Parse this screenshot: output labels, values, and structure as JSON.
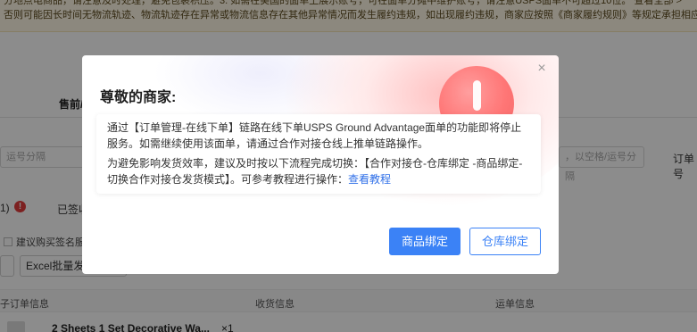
{
  "background": {
    "notice_line1": "分地点电商品，请注意及时处理，避免包裹积压。3. 如需在美国的面单上展示账号，可在面单分摊中维护账号，请注意USPS面单不可超过10位。  查看全部 >",
    "notice_line2": "否则可能因长时间无物流轨迹、物流轨迹存在异常或物流信息存在其他异常情况而发生履约违规，如出现履约违规，商家应按照《商家履约规则》等规定承担相应责任。",
    "notice_link": "查看全部 >",
    "tab_label": "售前/",
    "search_placeholder_left": "运号分隔",
    "search_placeholder_right": "，以空格/运号分隔",
    "search_label_right": "订单号",
    "status_count": "1)",
    "status_error_icon": "!",
    "status_signed": "已签收",
    "checkbox_label": "建议购买签名服务",
    "btn_excel": "Excel批量发",
    "table_col1": "子订单信息",
    "table_col2": "收货信息",
    "table_col3": "运单信息",
    "row_title": "2 Sheets 1 Set Decorative Wa...",
    "row_qty": "×1"
  },
  "dialog": {
    "title": "尊敬的商家:",
    "paragraph1": "通过【订单管理-在线下单】链路在线下单USPS Ground Advantage面单的功能即将停止服务。如需继续使用该面单，请通过合作对接仓线上推单链路操作。",
    "paragraph2_text": "为避免影响发货效率，建议及时按以下流程完成切换：【合作对接仓-仓库绑定 -商品绑定-切换合作对接仓发货模式】。可参考教程进行操作：",
    "paragraph2_link": "查看教程",
    "primary_button": "商品绑定",
    "secondary_button": "仓库绑定",
    "close_icon": "×"
  },
  "colors": {
    "primary": "#3b82f6",
    "alert": "#ff6b6b",
    "link": "#2f6fe8"
  },
  "icons": [
    "alert-exclamation-icon",
    "close-icon",
    "error-icon"
  ]
}
